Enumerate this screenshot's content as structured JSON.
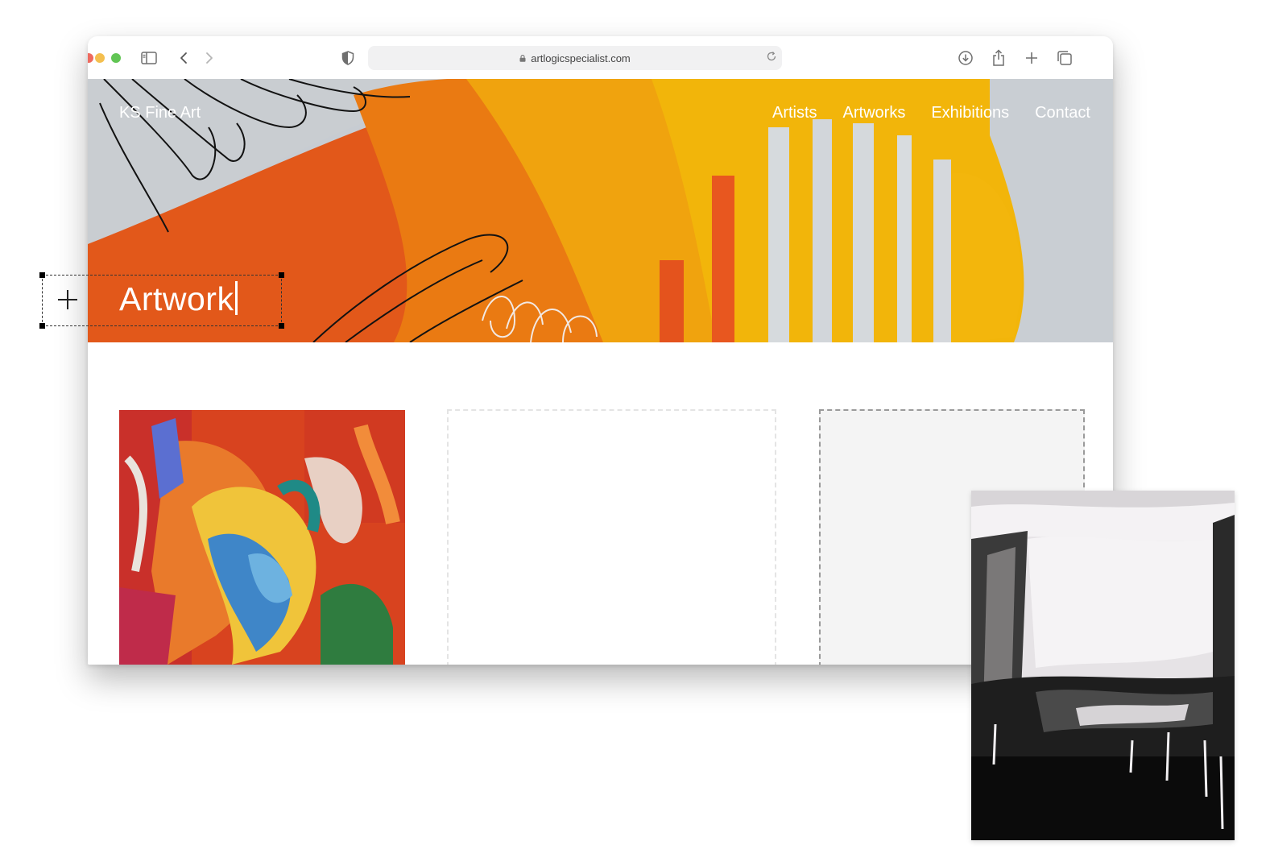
{
  "browser": {
    "url": "artlogicspecialist.com",
    "icons": [
      "sidebar-icon",
      "back-icon",
      "forward-icon",
      "shield-icon",
      "lock-icon",
      "reload-icon",
      "download-icon",
      "share-icon",
      "new-tab-icon",
      "tabs-overview-icon"
    ]
  },
  "site": {
    "logo": "KS Fine Art",
    "nav": [
      "Artists",
      "Artworks",
      "Exhibitions",
      "Contact"
    ],
    "hero_title": "Artwork"
  },
  "colors": {
    "hero_orange": "#e2581a",
    "hero_yellow": "#f1b408",
    "hero_grey": "#c7ccd2",
    "slot_border_active": "#9a9a9a",
    "slot_border_idle": "#e4e4e4"
  }
}
